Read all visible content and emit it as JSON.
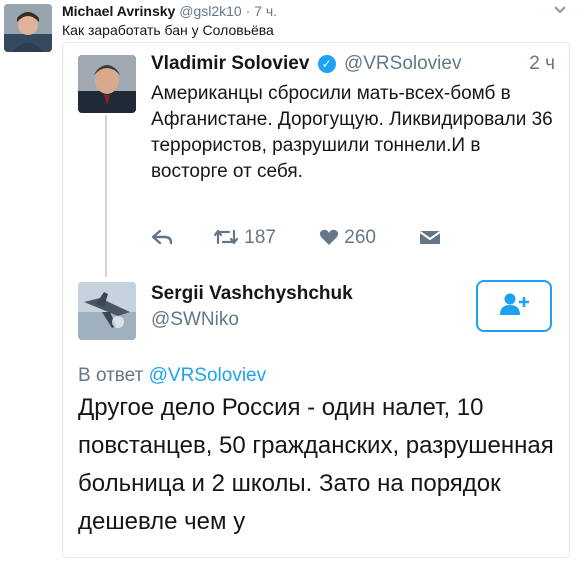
{
  "outer_tweet": {
    "author_name": "Michael Avrinsky",
    "author_handle": "@gsl2k10",
    "separator": "·",
    "time": "7 ч.",
    "text": "Как заработать бан у Соловьёва"
  },
  "screenshot": {
    "quoted_tweet": {
      "author_name": "Vladimir Soloviev",
      "author_handle": "@VRSoloviev",
      "time": "2 ч",
      "text": "Американцы сбросили мать-всех-бомб в Афганистане. Дорогущую. Ликвидировали 36 террористов, разрушили     тоннели.И в восторге от себя.",
      "actions": {
        "retweets": "187",
        "likes": "260"
      }
    },
    "reply_tweet": {
      "author_name": "Sergii Vashchyshchuk",
      "author_handle": "@SWNiko",
      "reply_prefix": "В ответ",
      "reply_to_handle": "@VRSoloviev",
      "text": "Другое дело Россия - один налет, 10 повстанцев, 50 гражданских, разрушенная больница и 2 школы. Зато на порядок дешевле чем у"
    }
  },
  "colors": {
    "accent": "#1da1f2",
    "secondary_text": "#657786",
    "primary_text": "#14171a",
    "border": "#e1e8ed"
  },
  "icons": [
    "verified-badge-icon",
    "reply-icon",
    "retweet-icon",
    "like-icon",
    "direct-message-icon",
    "follow-icon",
    "caret-down-icon"
  ]
}
